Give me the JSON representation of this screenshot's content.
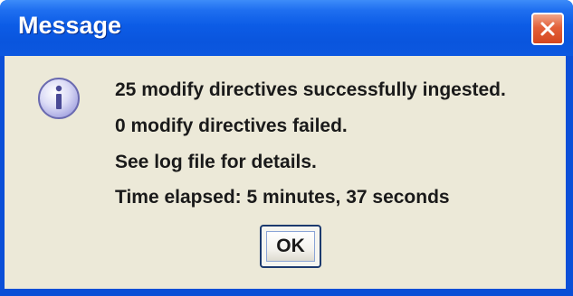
{
  "window": {
    "title": "Message"
  },
  "icons": {
    "close": "close-icon",
    "info": "information-icon"
  },
  "message": {
    "lines": [
      "25 modify directives successfully ingested.",
      "0 modify directives failed.",
      "See log file for details.",
      "Time elapsed: 5 minutes, 37 seconds"
    ]
  },
  "buttons": {
    "ok_label": "OK"
  },
  "colors": {
    "titlebar": "#0a55dd",
    "close_button": "#d4461f",
    "dialog_background": "#ece9d8"
  }
}
